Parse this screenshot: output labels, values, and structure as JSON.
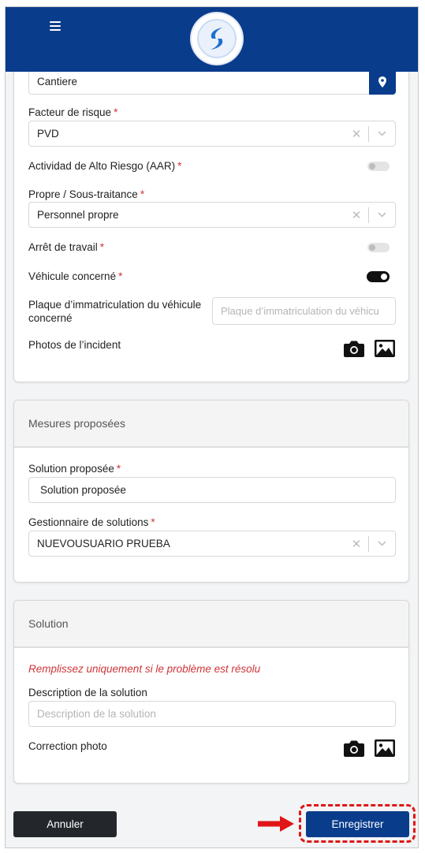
{
  "header": {
    "menu_icon": "hamburger-menu-icon",
    "logo": "app-logo"
  },
  "location": {
    "value": "Cantiere",
    "icon": "map-pin-icon"
  },
  "form": {
    "risk_factor": {
      "label": "Facteur de risque",
      "required": "*",
      "value": "PVD"
    },
    "aar": {
      "label": "Actividad de Alto Riesgo (AAR)",
      "required": "*",
      "checked": false
    },
    "ownership": {
      "label": "Propre / Sous-traitance",
      "required": "*",
      "value": "Personnel propre"
    },
    "work_stop": {
      "label": "Arrêt de travail",
      "required": "*",
      "checked": false
    },
    "vehicle": {
      "label": "Véhicule concerné",
      "required": "*",
      "checked": true
    },
    "plate": {
      "label": "Plaque d’immatriculation du véhicule concerné",
      "placeholder": "Plaque d’immatriculation du véhicu"
    },
    "photos": {
      "label": "Photos de l’incident"
    }
  },
  "measures": {
    "title": "Mesures proposées",
    "solution": {
      "label": "Solution proposée",
      "required": "*",
      "value": "Solution proposée"
    },
    "manager": {
      "label": "Gestionnaire de solutions",
      "required": "*",
      "value": "NUEVOUSUARIO PRUEBA"
    }
  },
  "solution_section": {
    "title": "Solution",
    "hint": "Remplissez uniquement si le problème est résolu",
    "description": {
      "label": "Description de la solution",
      "placeholder": "Description de la solution"
    },
    "correction_photo": {
      "label": "Correction photo"
    }
  },
  "actions": {
    "cancel": "Annuler",
    "save": "Enregistrer"
  },
  "colors": {
    "primary": "#0a3c8c",
    "required": "#d0343a",
    "highlight": "#e01616",
    "dark_button": "#23262b"
  }
}
